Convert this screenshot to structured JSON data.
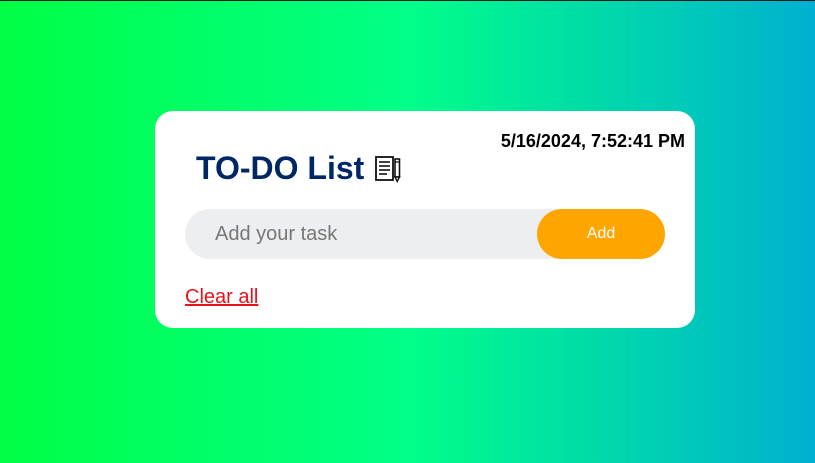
{
  "app": {
    "timestamp": "5/16/2024, 7:52:41 PM",
    "title": "TO-DO List",
    "title_icon": "notepad-icon"
  },
  "task_input": {
    "placeholder": "Add your task",
    "value": ""
  },
  "add_button": {
    "label": "Add"
  },
  "clear_link": {
    "label": "Clear all"
  },
  "colors": {
    "title": "#002765",
    "add_button": "#ffa500",
    "clear_link": "#e8121b",
    "input_background": "#edeef0",
    "card": "#ffffff",
    "background_gradient": [
      "#00ff44",
      "#00ff88",
      "#00b0d0"
    ]
  }
}
